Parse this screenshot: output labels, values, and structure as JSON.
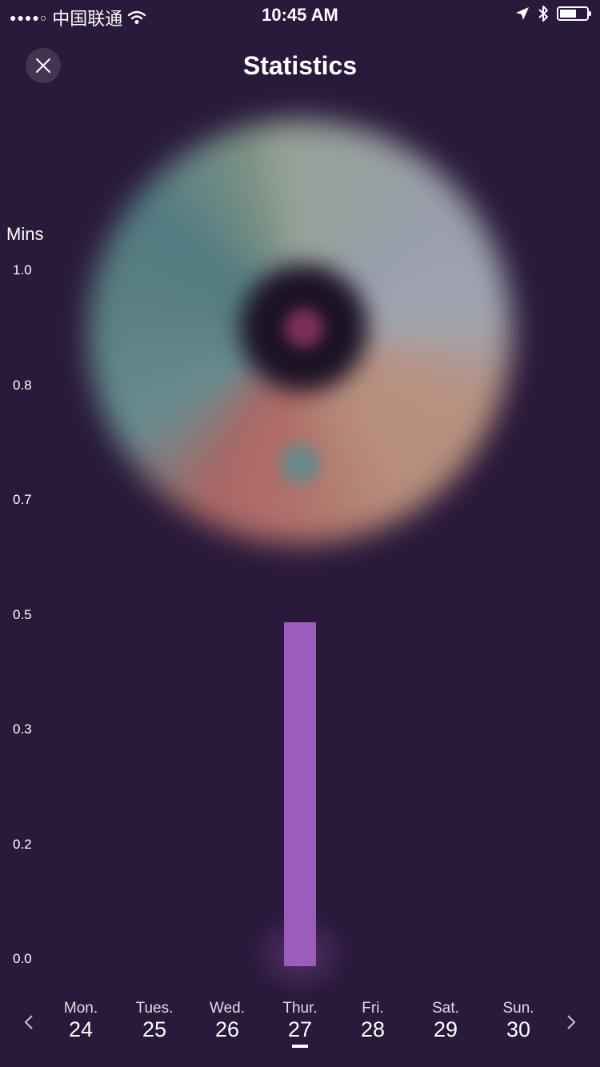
{
  "status_bar": {
    "signal": "●●●●○",
    "carrier": "中国联通",
    "time": "10:45 AM"
  },
  "header": {
    "title": "Statistics"
  },
  "chart_data": {
    "type": "bar",
    "ylabel": "Mins",
    "y_ticks": [
      "1.0",
      "0.8",
      "0.7",
      "0.5",
      "0.3",
      "0.2",
      "0.0"
    ],
    "ylim": [
      0,
      1.0
    ],
    "categories": [
      "Mon. 24",
      "Tues. 25",
      "Wed. 26",
      "Thur. 27",
      "Fri. 28",
      "Sat. 29",
      "Sun. 30"
    ],
    "values": [
      0,
      0,
      0,
      0.5,
      0,
      0,
      0
    ],
    "bar_color": "#9c5cbc"
  },
  "days": [
    {
      "name": "Mon.",
      "num": "24"
    },
    {
      "name": "Tues.",
      "num": "25"
    },
    {
      "name": "Wed.",
      "num": "26"
    },
    {
      "name": "Thur.",
      "num": "27"
    },
    {
      "name": "Fri.",
      "num": "28"
    },
    {
      "name": "Sat.",
      "num": "29"
    },
    {
      "name": "Sun.",
      "num": "30"
    }
  ],
  "selected_day_index": 3,
  "icons": {
    "close": "close-icon",
    "prev": "chevron-left-icon",
    "next": "chevron-right-icon"
  },
  "colors": {
    "background": "#29193a",
    "accent": "#9c5cbc"
  }
}
